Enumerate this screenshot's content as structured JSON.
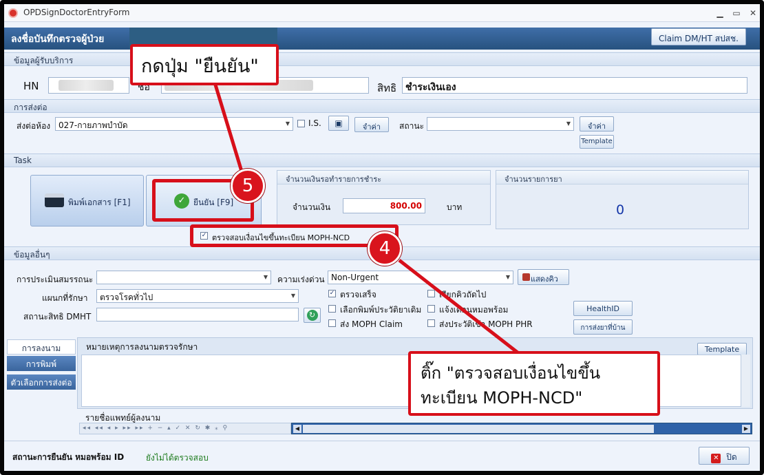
{
  "window": {
    "title": "OPDSignDoctorEntryForm",
    "minimize": "▁",
    "maximize": "▭",
    "close": "✕"
  },
  "header": {
    "title": "ลงชื่อบันทึกตรวจผู้ป่วย",
    "claim_button": "Claim DM/HT สปสช."
  },
  "patient": {
    "section": "ข้อมูลผู้รับบริการ",
    "hn_label": "HN",
    "name_label": "ชื่อ",
    "right_label": "สิทธิ",
    "right_value": "ชำระเงินเอง"
  },
  "referral": {
    "section": "การส่งต่อ",
    "room_label": "ส่งต่อห้อง",
    "room_value": "027-กายภาพบำบัด",
    "is_label": "I.S.",
    "remember_button": "จำค่า",
    "status_label": "สถานะ",
    "status_value": "",
    "remember_button2": "จำค่า",
    "template_button": "Template"
  },
  "task": {
    "section": "Task",
    "print_button": "พิมพ์เอกสาร [F1]",
    "confirm_button": "ยืนยัน [F9]",
    "payment_panel_title": "จำนวนเงินรอทำรายการชำระ",
    "amount_label": "จำนวนเงิน",
    "amount_value": "800.00",
    "currency": "บาท",
    "drug_panel_title": "จำนวนรายการยา",
    "drug_count": "0",
    "ncd_check_label": "ตรวจสอบเงื่อนไขขึ้นทะเบียน MOPH-NCD",
    "ncd_checked": true
  },
  "other": {
    "section": "ข้อมูลอื่นๆ",
    "assessment_label": "การประเมินสมรรถนะ",
    "assessment_value": "",
    "urgency_label": "ความเร่งด่วน",
    "urgency_value": "Non-Urgent",
    "show_queue_button": "แสดงคิว",
    "dept_label": "แผนกที่รักษา",
    "dept_value": "ตรวจโรคทั่วไป",
    "dmht_label": "สถานะสิทธิ DMHT",
    "dmht_value": "",
    "checks": [
      {
        "label": "ตรวจเสร็จ",
        "checked": true
      },
      {
        "label": "เรียกคิวถัดไป",
        "checked": false
      },
      {
        "label": "เลือกพิมพ์ประวัติยาเดิม",
        "checked": false
      },
      {
        "label": "แจ้งเตือนหมอพร้อม",
        "checked": false
      },
      {
        "label": "ส่ง MOPH Claim",
        "checked": false
      },
      {
        "label": "ส่งประวัติเข้า MOPH PHR",
        "checked": false
      }
    ],
    "healthid_button": "HealthID",
    "home_drug_button": "การส่งยาที่บ้าน"
  },
  "notes": {
    "tabs": [
      "การลงนาม",
      "การพิมพ์",
      "ตัวเลือกการส่งต่อ"
    ],
    "note_label": "หมายเหตุการลงนามตรวจรักษา",
    "template_button": "Template",
    "doctor_list_label": "รายชื่อแพทย์ผู้ลงนาม",
    "nav_symbols": "◂◂ ◂◂ ◂ ▸ ▸▸ ▸▸ + − ▴ ✓ ✕ ↻ ✱ ⁎ ⚲"
  },
  "status": {
    "label": "สถานะการยืนยัน หมอพร้อม ID",
    "value": "ยังไม่ได้ตรวจสอบ",
    "close_button": "ปิด"
  },
  "annotations": {
    "step5_number": "5",
    "step5_text": "กดปุ่ม \"ยืนยัน\"",
    "step4_number": "4",
    "step4_line1": "ติ๊ก \"ตรวจสอบเงื่อนไขขึ้น",
    "step4_line2": "ทะเบียน MOPH-NCD\""
  },
  "colors": {
    "accent": "#27527f",
    "annotation_red": "#d70f1a",
    "amount_red": "#d40000",
    "status_green": "#1c7a1c"
  }
}
